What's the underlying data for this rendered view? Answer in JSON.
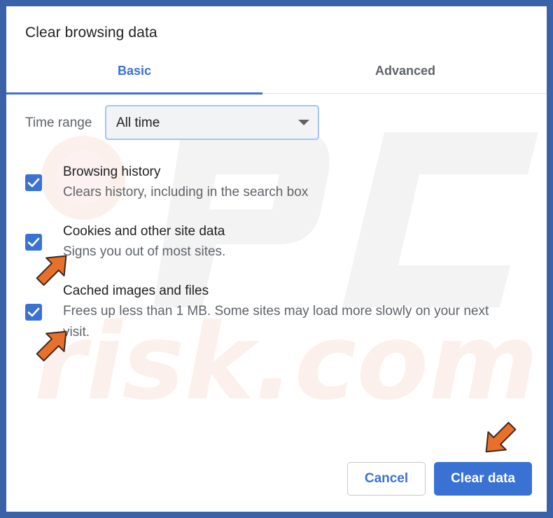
{
  "dialog": {
    "title": "Clear browsing data"
  },
  "tabs": [
    {
      "label": "Basic",
      "selected": true
    },
    {
      "label": "Advanced",
      "selected": false
    }
  ],
  "time_range": {
    "label": "Time range",
    "value": "All time"
  },
  "options": [
    {
      "title": "Browsing history",
      "description": "Clears history, including in the search box",
      "checked": true
    },
    {
      "title": "Cookies and other site data",
      "description": "Signs you out of most sites.",
      "checked": true
    },
    {
      "title": "Cached images and files",
      "description": "Frees up less than 1 MB. Some sites may load more slowly on your next visit.",
      "checked": true
    }
  ],
  "buttons": {
    "cancel": "Cancel",
    "clear": "Clear data"
  },
  "colors": {
    "accent": "#3a72d4",
    "frame": "#3a62a8",
    "annotation_arrow": "#e8702a"
  },
  "watermark": "PC risk.com"
}
